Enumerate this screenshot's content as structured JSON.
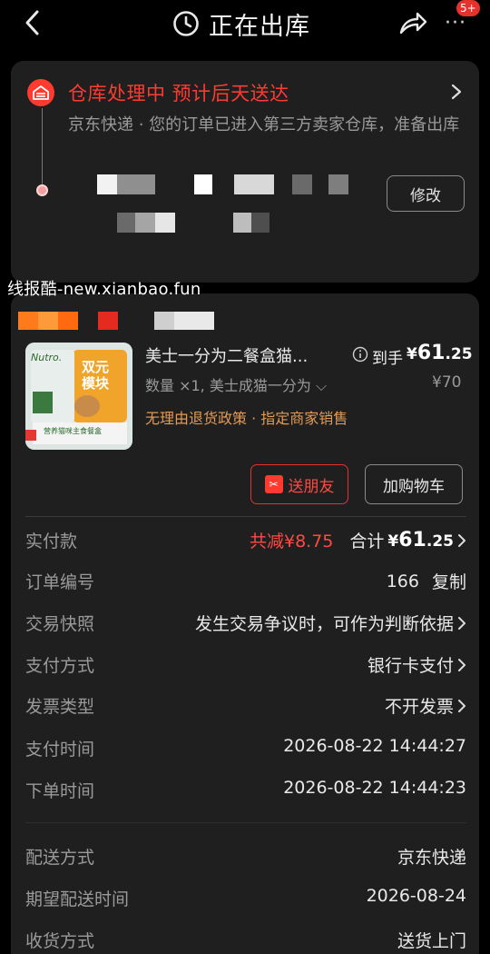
{
  "header": {
    "title": "正在出库",
    "badge": "5+",
    "icons": [
      "back-icon",
      "clock-icon",
      "share-icon",
      "more-icon"
    ]
  },
  "status": {
    "title": "仓库处理中 预计后天送达",
    "description": "京东快递 · 您的订单已进入第三方卖家仓库，准备出库",
    "modify_label": "修改",
    "icon": "warehouse-icon"
  },
  "watermark": "线报酷-new.xianbao.fun",
  "product": {
    "name": "美士一分为二餐盒猫...",
    "price_label": "到手",
    "price_currency": "¥",
    "price_int": "61",
    "price_dec": ".25",
    "spec": "数量 ×1, 美士成猫一分为",
    "original_price": "¥70",
    "policy": "无理由退货政策 · 指定商家销售",
    "image_text": {
      "brand": "Nutro.",
      "badge_line1": "双元",
      "badge_line2": "模块",
      "caption": "营养猫咪主食餐盒"
    }
  },
  "actions": {
    "gift_label": "送朋友",
    "cart_label": "加购物车"
  },
  "payment": {
    "paid_label": "实付款",
    "discount": "共减¥8.75",
    "total_label": "合计",
    "total_currency": "¥",
    "total_int": "61",
    "total_dec": ".25"
  },
  "rows": [
    {
      "label": "订单编号",
      "value": "166",
      "extra": "复制"
    },
    {
      "label": "交易快照",
      "value": "发生交易争议时，可作为判断依据"
    },
    {
      "label": "支付方式",
      "value": "银行卡支付"
    },
    {
      "label": "发票类型",
      "value": "不开发票"
    },
    {
      "label": "支付时间",
      "value": "2026-08-22 14:44:27"
    },
    {
      "label": "下单时间",
      "value": "2026-08-22 14:44:23"
    },
    {
      "label": "配送方式",
      "value": "京东快递"
    },
    {
      "label": "期望配送时间",
      "value": "2026-08-24"
    },
    {
      "label": "收货方式",
      "value": "送货上门"
    }
  ],
  "colors": {
    "accent_red": "#ff3b30",
    "policy_orange": "#e29a55",
    "card_bg": "#1f1f1f",
    "page_bg": "#000000"
  }
}
